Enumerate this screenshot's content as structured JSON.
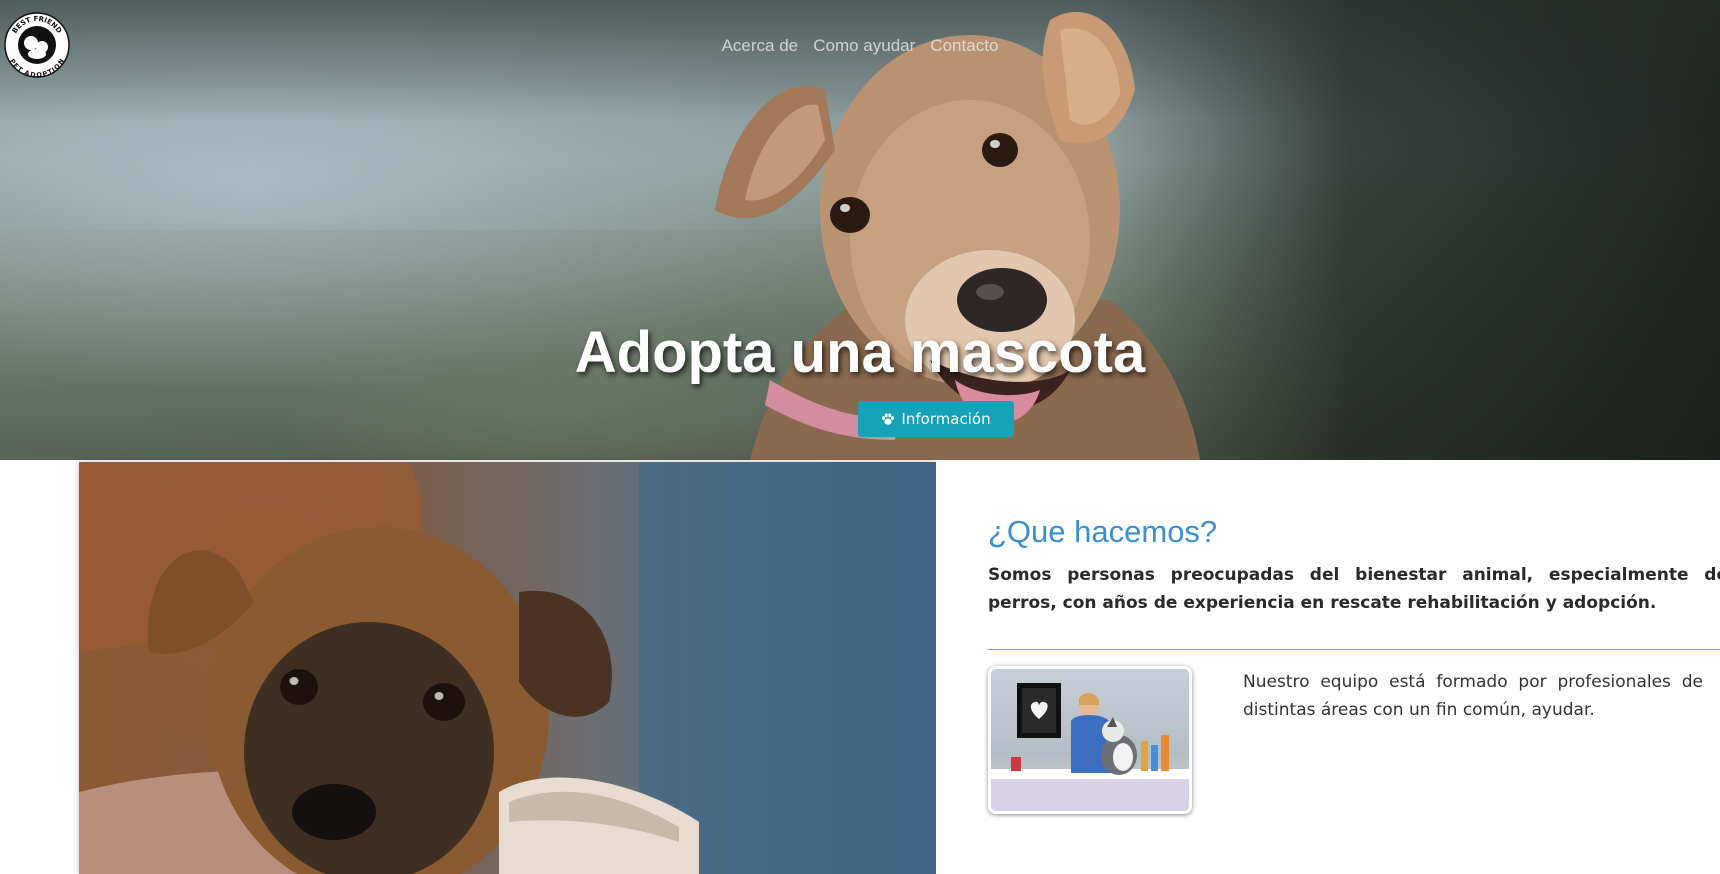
{
  "brand": {
    "logo_top_text": "BEST FRIEND",
    "logo_bottom_text": "PET ADOPTION"
  },
  "nav": {
    "items": [
      {
        "label": "Acerca de"
      },
      {
        "label": "Como ayudar"
      },
      {
        "label": "Contacto"
      }
    ]
  },
  "hero": {
    "title": "Adopta una mascota",
    "button_label": "Información",
    "button_icon": "paw-icon",
    "button_color": "#17a2b8"
  },
  "about": {
    "title": "¿Que hacemos?",
    "title_color": "#3a8fcf",
    "lead": "Somos personas preocupadas del bienestar animal, especialmente de perros, con años de experiencia en rescate rehabilitación y adopción.",
    "divider_color": "#e07b56",
    "team_text": "Nuestro equipo está formado por profesionales de distintas áreas con un fin común, ayudar."
  }
}
